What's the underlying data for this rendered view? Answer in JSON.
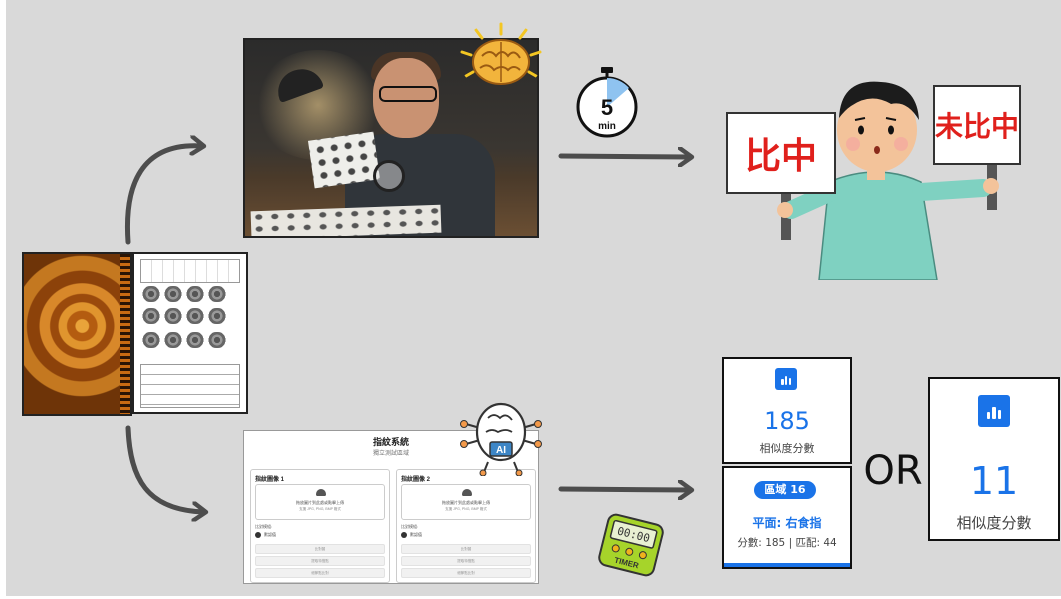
{
  "stopwatch": {
    "value": "5",
    "unit": "min"
  },
  "signs": {
    "matched": "比中",
    "unmatched": "未比中"
  },
  "ai_brain": {
    "label": "AI"
  },
  "system_ui": {
    "title": "指紋系統",
    "subtitle": "獨立測試區域",
    "panel1": "指紋圖像 1",
    "panel2": "指紋圖像 2",
    "upload_text": "拖放圖片到此處或點擊上傳",
    "format_text": "支援 JPG, PNG, BMP 格式",
    "module_label": "比對模組:",
    "module_option": "默認值",
    "btn1": "比對圖",
    "btn2": "提取特徵點",
    "btn3": "細節點比對"
  },
  "timer": {
    "display": "00:00",
    "label": "TIMER"
  },
  "result_card_1": {
    "value": "185",
    "label": "相似度分數"
  },
  "result_card_2": {
    "badge": "區域 16",
    "plane": "平面: 右食指",
    "scores": "分數: 185 | 匹配: 44"
  },
  "or_text": "OR",
  "result_card_3": {
    "value": "11",
    "label": "相似度分數"
  },
  "colors": {
    "accent": "#1a73e8",
    "sign_text": "#e0201c",
    "arrow": "#4d4d4d",
    "background": "#d9d9d9"
  }
}
